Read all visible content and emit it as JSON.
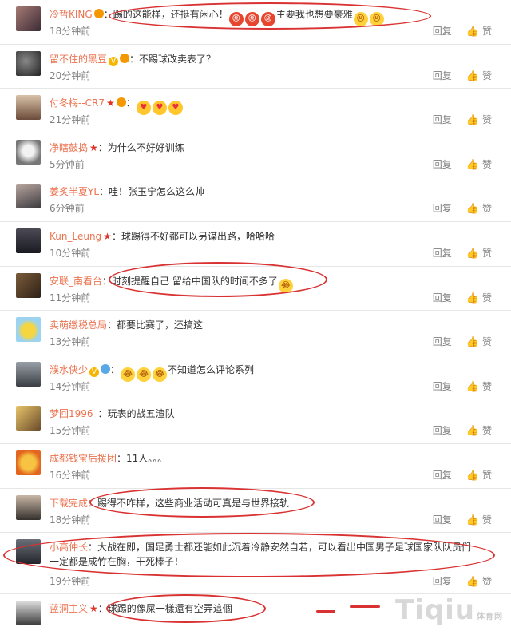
{
  "labels": {
    "reply": "回复",
    "like": "赞"
  },
  "comments": [
    {
      "user": "冷哲KING",
      "text": "踢的这能样，还挺有闲心！",
      "text2": "主要我也想要豪雅",
      "time": "18分钟前"
    },
    {
      "user": "留不住的黑豆",
      "text": "不踢球改卖表了？",
      "time": "20分钟前"
    },
    {
      "user": "付冬梅--CR7",
      "text": "",
      "time": "21分钟前"
    },
    {
      "user": "净瞎鼓捣",
      "text": "为什么不好好训练",
      "time": "5分钟前"
    },
    {
      "user": "姜炙半夏YL",
      "text": "哇！张玉宁怎么这么帅",
      "time": "6分钟前"
    },
    {
      "user": "Kun_Leung",
      "text": "球踢得不好都可以另谋出路，哈哈哈",
      "time": "10分钟前"
    },
    {
      "user": "安联_南看台",
      "text": "时刻提醒自己 留给中国队的时间不多了",
      "time": "11分钟前"
    },
    {
      "user": "卖萌缴税总局",
      "text": "都要比赛了，还搞这",
      "time": "13分钟前"
    },
    {
      "user": "濮水侠少",
      "text": "不知道怎么评论系列",
      "time": "14分钟前"
    },
    {
      "user": "梦回1996_",
      "text": "玩表的战五渣队",
      "time": "15分钟前"
    },
    {
      "user": "成都钱宝后援团",
      "text": "11人。。。",
      "time": "16分钟前"
    },
    {
      "user": "下载完成",
      "text": "踢得不咋样，这些商业活动可真是与世界接轨",
      "time": "18分钟前"
    },
    {
      "user": "小高仲长",
      "text": "大战在即，国足勇士都还能如此沉着冷静安然自若，可以看出中国男子足球国家队队员们",
      "text2": "一定都是成竹在胸，干死棒子！",
      "time": "19分钟前"
    },
    {
      "user": "蓝洞主义",
      "text": "球踢的像屎一樣還有空弄這個",
      "time": ""
    }
  ],
  "watermark": {
    "main": "Tiqiu",
    "sub": "体育网"
  },
  "colors": {
    "username": "#eb7350",
    "highlight": "#d93232",
    "meta": "#808080"
  }
}
